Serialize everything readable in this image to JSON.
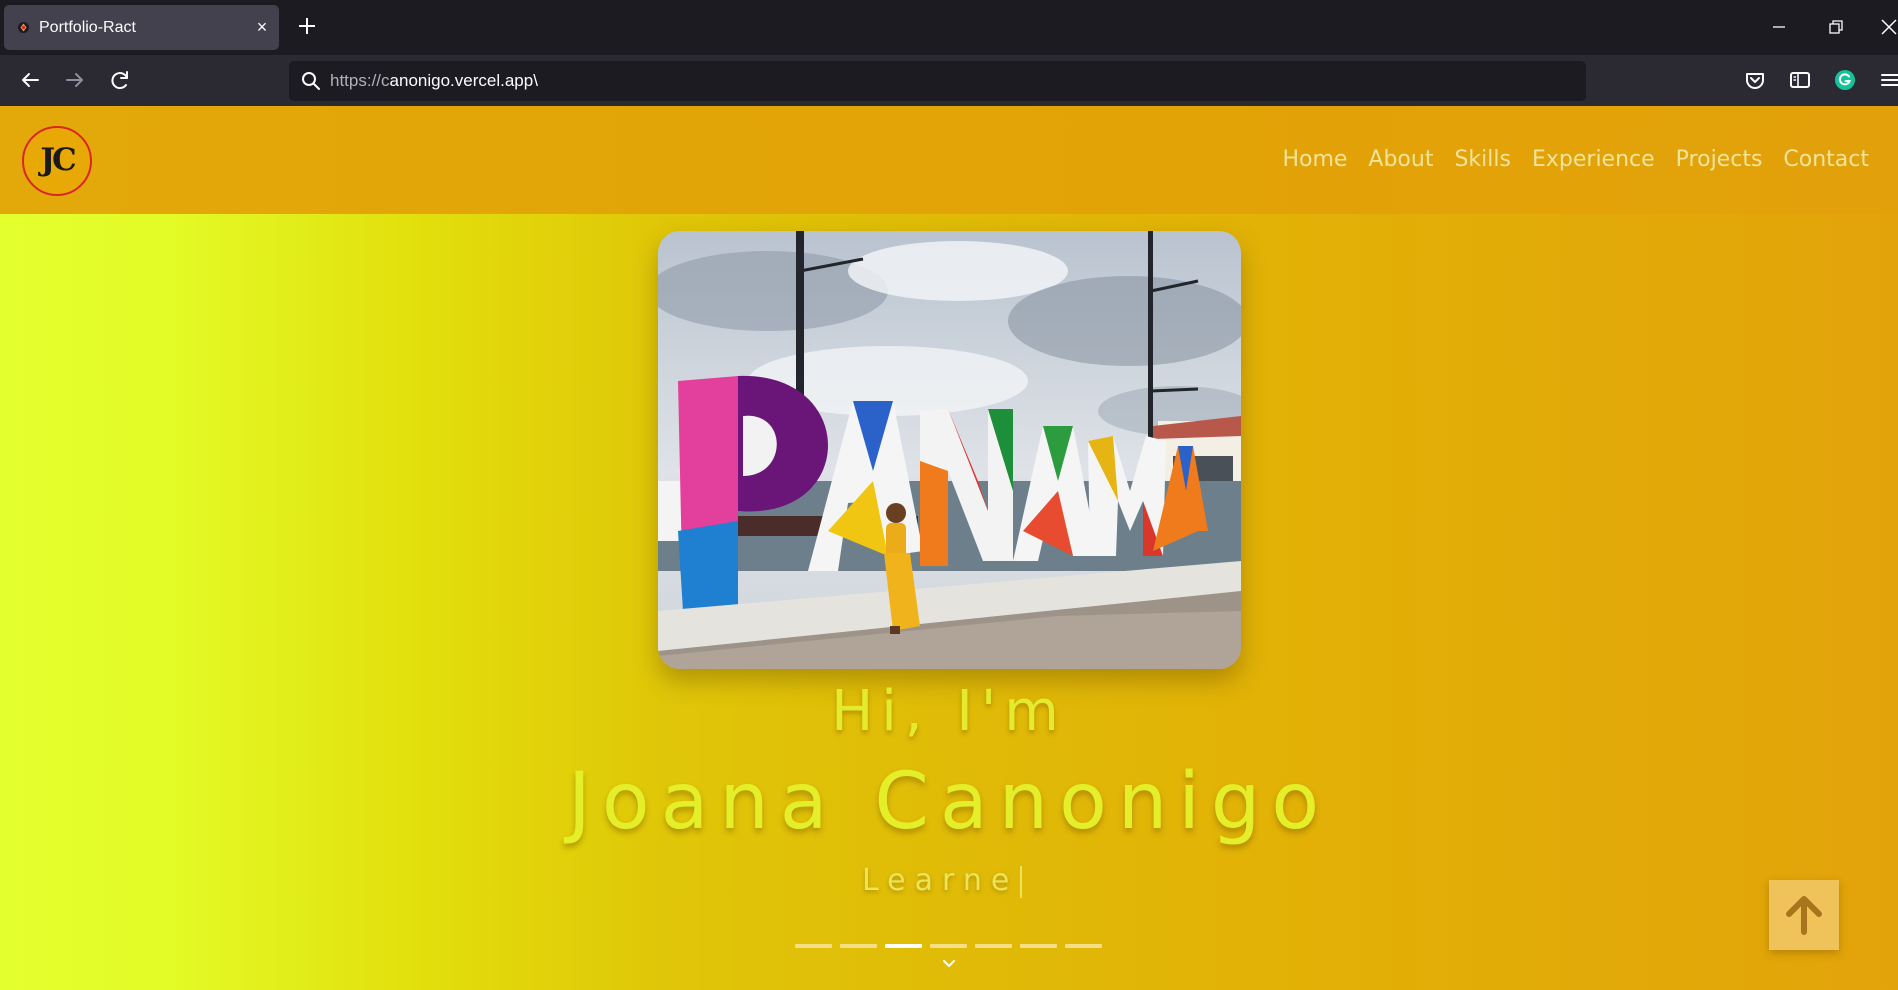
{
  "browser": {
    "tab": {
      "title": "Portfolio-Ract"
    },
    "url": {
      "prefix": "https://c",
      "rest": "anonigo.vercel.app\\"
    }
  },
  "site": {
    "logo": "JC",
    "nav": [
      "Home",
      "About",
      "Skills",
      "Experience",
      "Projects",
      "Contact"
    ],
    "hero": {
      "photo_alt": "PANAMA",
      "greeting": "Hi, I'm",
      "name": "Joana Canonigo",
      "role_typed": "Learne",
      "carousel": {
        "count": 7,
        "active_index": 2
      }
    }
  },
  "colors": {
    "chrome_dark": "#1c1b22",
    "chrome_bar": "#2b2a33",
    "header": "#e2a306",
    "accent_text": "#e4ef2a",
    "logo_ring": "#d92626",
    "back_to_top": "#efc35a",
    "arrow": "#a8741c"
  }
}
